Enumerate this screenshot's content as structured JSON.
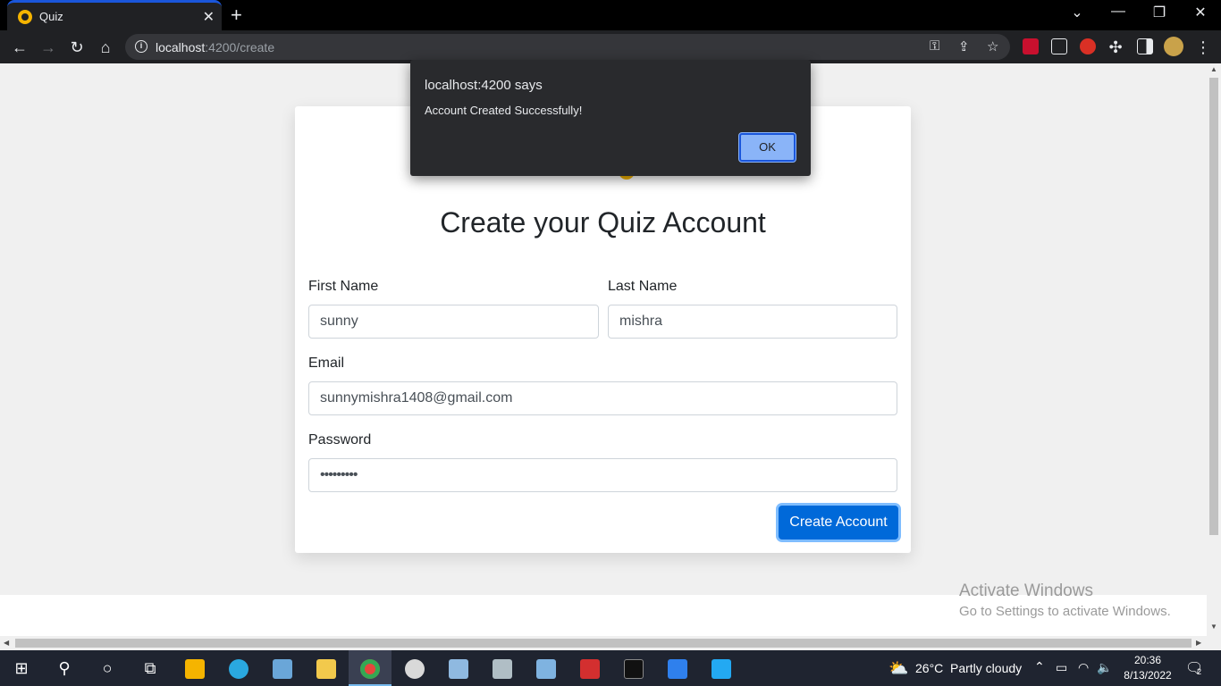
{
  "browser": {
    "tab_title": "Quiz",
    "tab_close": "✕",
    "new_tab": "+",
    "window_controls": {
      "dropdown": "⌄",
      "minimize": "—",
      "restore": "❐",
      "close": "✕"
    },
    "url_host": "localhost",
    "url_path": ":4200/create",
    "info_icon": "i"
  },
  "page": {
    "title": "Create your Quiz Account",
    "form": {
      "first_name_label": "First Name",
      "first_name_value": "sunny",
      "last_name_label": "Last Name",
      "last_name_value": "mishra",
      "email_label": "Email",
      "email_value": "sunnymishra1408@gmail.com",
      "password_label": "Password",
      "password_value": "•••••••••",
      "submit_label": "Create Account"
    }
  },
  "dialog": {
    "title": "localhost:4200 says",
    "message": "Account Created Successfully!",
    "ok_label": "OK"
  },
  "watermark": {
    "line1": "Activate Windows",
    "line2": "Go to Settings to activate Windows."
  },
  "taskbar": {
    "weather_temp": "26°C",
    "weather_text": "Partly cloudy",
    "time": "20:36",
    "date": "8/13/2022",
    "notification_count": "2"
  },
  "colors": {
    "accent": "#0069d9",
    "dialog_bg": "#292a2d",
    "ok_button": "#8ab4f8"
  }
}
